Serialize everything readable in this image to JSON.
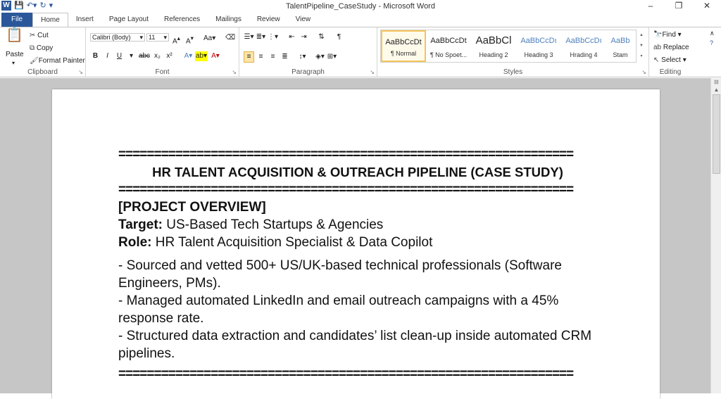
{
  "window": {
    "title": "TalentPipeline_CaseStudy - Microsoft Word",
    "controls": [
      "–",
      "❐",
      "✕"
    ]
  },
  "tabs": [
    "File",
    "Home",
    "Insert",
    "Page Layout",
    "References",
    "Mailings",
    "Review",
    "View"
  ],
  "clipboard": {
    "paste": "Paste",
    "cut": "Cut",
    "copy": "Copy",
    "format_painter": "Format Painter",
    "label": "Clipboard"
  },
  "font": {
    "family": "Calibri (Body)",
    "size": "11",
    "label": "Font"
  },
  "paragraph": {
    "label": "Paragraph"
  },
  "styles": {
    "label": "Styles",
    "items": [
      {
        "preview": "AaBbCcDt",
        "name": "¶ Normal"
      },
      {
        "preview": "AaBbCcDt",
        "name": "¶ No Spoet..."
      },
      {
        "preview": "AaBbCl",
        "name": "Heading 2"
      },
      {
        "preview": "AaBbCcDı",
        "name": "Heading 3"
      },
      {
        "preview": "AaBbCcDı",
        "name": "Hrading 4"
      },
      {
        "preview": "AaBb",
        "name": "Stam"
      }
    ]
  },
  "editing": {
    "find": "Find ▾",
    "replace": "Replace",
    "select": "Select ▾",
    "label": "Editing"
  },
  "document": {
    "rule": "================================================================",
    "title": "HR TALENT ACQUISITION & OUTREACH PIPELINE (CASE STUDY)",
    "section": "[PROJECT OVERVIEW]",
    "target_label": "Target:",
    "target_value": " US-Based Tech Startups & Agencies",
    "role_label": "Role:",
    "role_value": " HR Talent Acquisition Specialist & Data Copilot",
    "bullets": [
      "- Sourced and vetted 500+ US/UK-based technical professionals (Software Engineers, PMs).",
      "- Managed automated LinkedIn and email outreach campaigns with a 45% response rate.",
      "- Structured data extraction and candidates’ list clean-up inside automated CRM pipelines."
    ]
  }
}
